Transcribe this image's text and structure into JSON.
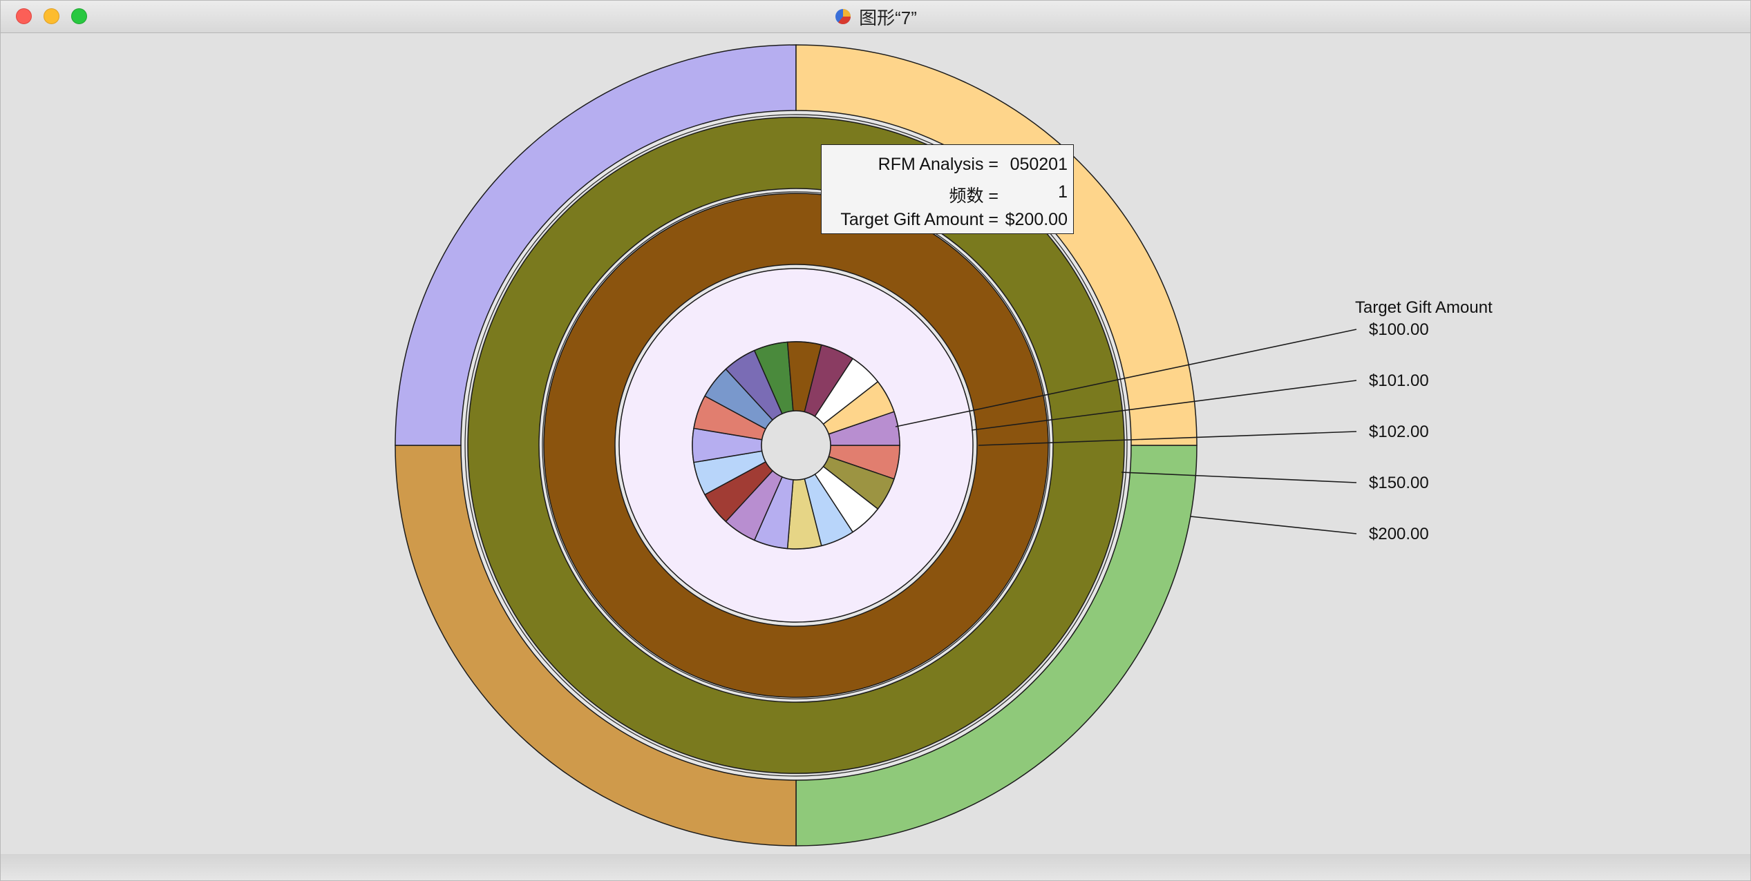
{
  "window": {
    "title": "图形“7”",
    "app_icon": "pie-chart-icon"
  },
  "tooltip": {
    "rows": [
      {
        "label": "RFM Analysis =",
        "value": "050201"
      },
      {
        "label": "频数 =",
        "value": "1"
      },
      {
        "label": "Target Gift Amount =",
        "value": "$200.00"
      }
    ]
  },
  "chart_data": {
    "type": "pie",
    "title": "",
    "legend_position": "right",
    "legend_title": "Target Gift Amount",
    "categories": [
      "$100.00",
      "$101.00",
      "$102.00",
      "$150.00",
      "$200.00"
    ],
    "rings": [
      {
        "slices": [
          {
            "label": "",
            "value": 25,
            "color": "#8fc97a"
          },
          {
            "label": "",
            "value": 25,
            "color": "#cf9a4b"
          },
          {
            "label": "",
            "value": 25,
            "color": "#b6aef0"
          },
          {
            "label": "",
            "value": 25,
            "color": "#fed58b"
          }
        ]
      },
      {
        "slices": [
          {
            "label": "",
            "value": 100,
            "color": "#7a7a1e"
          }
        ]
      },
      {
        "slices": [
          {
            "label": "",
            "value": 100,
            "color": "#8b540e"
          }
        ]
      },
      {
        "slices": [
          {
            "label": "",
            "value": 100,
            "color": "#f5ecfd"
          }
        ]
      },
      {
        "slices": [
          {
            "label": "",
            "value": 1,
            "color": "#e17e6f"
          },
          {
            "label": "",
            "value": 1,
            "color": "#9c9442"
          },
          {
            "label": "",
            "value": 1,
            "color": "#ffffff"
          },
          {
            "label": "",
            "value": 1,
            "color": "#b8d5fa"
          },
          {
            "label": "",
            "value": 1,
            "color": "#e6d586"
          },
          {
            "label": "",
            "value": 1,
            "color": "#b6aef0"
          },
          {
            "label": "",
            "value": 1,
            "color": "#b88ed0"
          },
          {
            "label": "",
            "value": 1,
            "color": "#a13c34"
          },
          {
            "label": "",
            "value": 1,
            "color": "#b8d5fa"
          },
          {
            "label": "",
            "value": 1,
            "color": "#b6aef0"
          },
          {
            "label": "",
            "value": 1,
            "color": "#e17e6f"
          },
          {
            "label": "",
            "value": 1,
            "color": "#7998cc"
          },
          {
            "label": "",
            "value": 1,
            "color": "#7a6cb5"
          },
          {
            "label": "",
            "value": 1,
            "color": "#4a8a3c"
          },
          {
            "label": "",
            "value": 1,
            "color": "#8b540e"
          },
          {
            "label": "",
            "value": 1,
            "color": "#8a3c62"
          },
          {
            "label": "",
            "value": 1,
            "color": "#ffffff"
          },
          {
            "label": "",
            "value": 1,
            "color": "#fed58b"
          },
          {
            "label": "",
            "value": 1,
            "color": "#b88ed0"
          }
        ]
      }
    ]
  }
}
